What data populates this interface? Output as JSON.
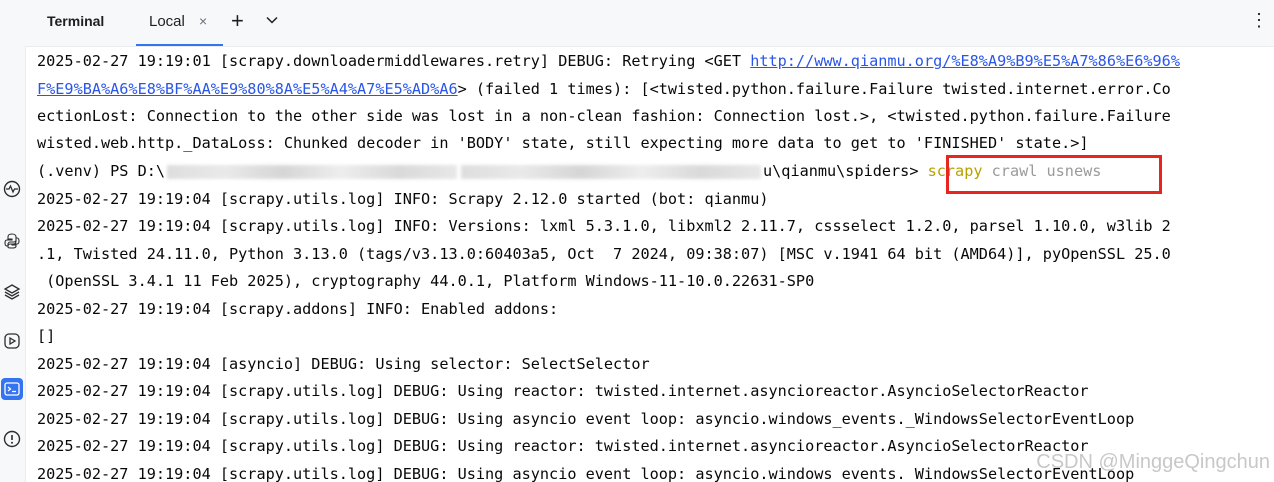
{
  "header": {
    "title": "Terminal",
    "tab_label": "Local",
    "close_glyph": "×",
    "plus_glyph": "+",
    "menu_glyph": "⋮"
  },
  "sidebar": {
    "icons": [
      "diagnostics-icon",
      "python-console-icon",
      "layers-icon",
      "run-icon",
      "terminal-icon",
      "problems-icon"
    ],
    "active": "terminal-icon",
    "accent": "#3574f0"
  },
  "terminal": {
    "line1_prefix": "2025-02-27 19:19:01 [scrapy.downloadermiddlewares.retry] DEBUG: Retrying <GET ",
    "line1_link": "http://www.qianmu.org/%E8%A9%B9%E5%A7%86%E6%96%",
    "line2_link": "F%E9%BA%A6%E8%BF%AA%E9%80%8A%E5%A4%A7%E5%AD%A6",
    "line2_rest": "> (failed 1 times): [<twisted.python.failure.Failure twisted.internet.error.Co",
    "line3": "ectionLost: Connection to the other side was lost in a non-clean fashion: Connection lost.>, <twisted.python.failure.Failure",
    "line4": "wisted.web.http._DataLoss: Chunked decoder in 'BODY' state, still expecting more data to get to 'FINISHED' state.>]",
    "prompt_start": "(.venv) PS D:\\",
    "prompt_end": "u\\qianmu\\spiders>",
    "cmd_word": "scrapy",
    "cmd_args": "crawl usnews",
    "line6": "2025-02-27 19:19:04 [scrapy.utils.log] INFO: Scrapy 2.12.0 started (bot: qianmu)",
    "line7": "2025-02-27 19:19:04 [scrapy.utils.log] INFO: Versions: lxml 5.3.1.0, libxml2 2.11.7, cssselect 1.2.0, parsel 1.10.0, w3lib 2",
    "line8": ".1, Twisted 24.11.0, Python 3.13.0 (tags/v3.13.0:60403a5, Oct  7 2024, 09:38:07) [MSC v.1941 64 bit (AMD64)], pyOpenSSL 25.0",
    "line9": " (OpenSSL 3.4.1 11 Feb 2025), cryptography 44.0.1, Platform Windows-11-10.0.22631-SP0",
    "line10": "2025-02-27 19:19:04 [scrapy.addons] INFO: Enabled addons:",
    "line11": "[]",
    "line12": "2025-02-27 19:19:04 [asyncio] DEBUG: Using selector: SelectSelector",
    "line13": "2025-02-27 19:19:04 [scrapy.utils.log] DEBUG: Using reactor: twisted.internet.asyncioreactor.AsyncioSelectorReactor",
    "line14": "2025-02-27 19:19:04 [scrapy.utils.log] DEBUG: Using asyncio event loop: asyncio.windows_events._WindowsSelectorEventLoop",
    "line15": "2025-02-27 19:19:04 [scrapy.utils.log] DEBUG: Using reactor: twisted.internet.asyncioreactor.AsyncioSelectorReactor",
    "line16": "2025-02-27 19:19:04 [scrapy.utils.log] DEBUG: Using asyncio event loop: asyncio.windows_events._WindowsSelectorEventLoop"
  },
  "watermark": "CSDN @MinggeQingchun"
}
